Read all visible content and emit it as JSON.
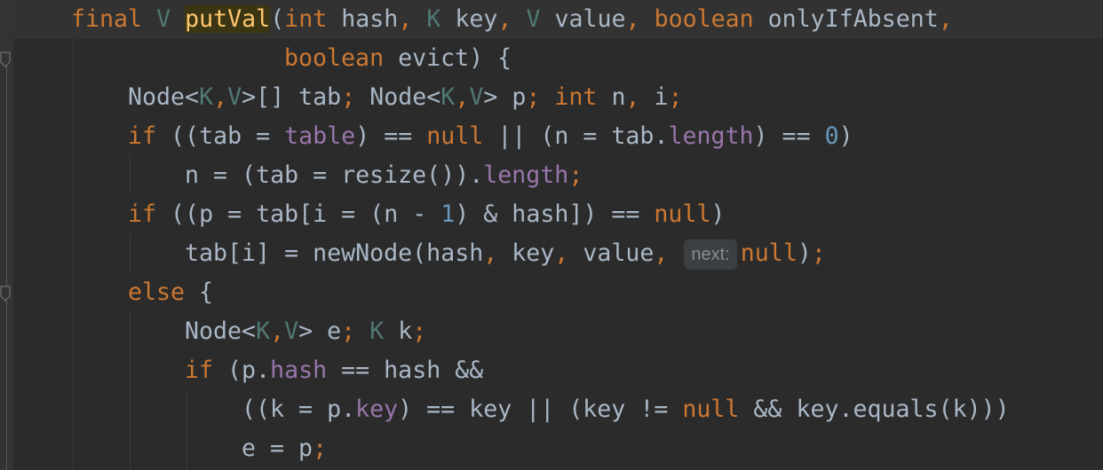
{
  "editor": {
    "lines": [
      [
        {
          "t": "final",
          "c": "kw"
        },
        {
          "t": " "
        },
        {
          "t": "V",
          "c": "typ"
        },
        {
          "t": " "
        },
        {
          "t": "putVal",
          "c": "fn-decl"
        },
        {
          "t": "("
        },
        {
          "t": "int",
          "c": "kw"
        },
        {
          "t": " hash"
        },
        {
          "t": ",",
          "c": "kw"
        },
        {
          "t": " "
        },
        {
          "t": "K",
          "c": "typ"
        },
        {
          "t": " key"
        },
        {
          "t": ",",
          "c": "kw"
        },
        {
          "t": " "
        },
        {
          "t": "V",
          "c": "typ"
        },
        {
          "t": " value"
        },
        {
          "t": ",",
          "c": "kw"
        },
        {
          "t": " "
        },
        {
          "t": "boolean",
          "c": "kw"
        },
        {
          "t": " onlyIfAbsent"
        },
        {
          "t": ",",
          "c": "kw"
        }
      ],
      [
        {
          "t": "boolean",
          "c": "kw"
        },
        {
          "t": " evict) {"
        }
      ],
      [
        {
          "t": "Node<"
        },
        {
          "t": "K",
          "c": "typ"
        },
        {
          "t": ",",
          "c": "kw"
        },
        {
          "t": "V",
          "c": "typ"
        },
        {
          "t": ">[] tab"
        },
        {
          "t": ";",
          "c": "kw"
        },
        {
          "t": " Node<"
        },
        {
          "t": "K",
          "c": "typ"
        },
        {
          "t": ",",
          "c": "kw"
        },
        {
          "t": "V",
          "c": "typ"
        },
        {
          "t": "> p"
        },
        {
          "t": ";",
          "c": "kw"
        },
        {
          "t": " "
        },
        {
          "t": "int",
          "c": "kw"
        },
        {
          "t": " n"
        },
        {
          "t": ",",
          "c": "kw"
        },
        {
          "t": " i"
        },
        {
          "t": ";",
          "c": "kw"
        }
      ],
      [
        {
          "t": "if",
          "c": "kw"
        },
        {
          "t": " ((tab = "
        },
        {
          "t": "table",
          "c": "fld"
        },
        {
          "t": ") == "
        },
        {
          "t": "null",
          "c": "kw"
        },
        {
          "t": " || (n = tab."
        },
        {
          "t": "length",
          "c": "fld"
        },
        {
          "t": ") == "
        },
        {
          "t": "0",
          "c": "num"
        },
        {
          "t": ")"
        }
      ],
      [
        {
          "t": "n = (tab = resize())."
        },
        {
          "t": "length",
          "c": "fld"
        },
        {
          "t": ";",
          "c": "kw"
        }
      ],
      [
        {
          "t": "if",
          "c": "kw"
        },
        {
          "t": " ((p = tab[i = (n - "
        },
        {
          "t": "1",
          "c": "num"
        },
        {
          "t": ") & hash]) == "
        },
        {
          "t": "null",
          "c": "kw"
        },
        {
          "t": ")"
        }
      ],
      [
        {
          "t": "tab[i] = newNode(hash"
        },
        {
          "t": ",",
          "c": "kw"
        },
        {
          "t": " key"
        },
        {
          "t": ",",
          "c": "kw"
        },
        {
          "t": " value"
        },
        {
          "t": ",",
          "c": "kw"
        },
        {
          "t": " "
        },
        {
          "t": "next:",
          "c": "hint"
        },
        {
          "t": "null",
          "c": "kw"
        },
        {
          "t": ")"
        },
        {
          "t": ";",
          "c": "kw"
        }
      ],
      [
        {
          "t": "else",
          "c": "kw"
        },
        {
          "t": " {"
        }
      ],
      [
        {
          "t": "Node<"
        },
        {
          "t": "K",
          "c": "typ"
        },
        {
          "t": ",",
          "c": "kw"
        },
        {
          "t": "V",
          "c": "typ"
        },
        {
          "t": "> e"
        },
        {
          "t": ";",
          "c": "kw"
        },
        {
          "t": " "
        },
        {
          "t": "K",
          "c": "typ"
        },
        {
          "t": " k"
        },
        {
          "t": ";",
          "c": "kw"
        }
      ],
      [
        {
          "t": "if",
          "c": "kw"
        },
        {
          "t": " (p."
        },
        {
          "t": "hash",
          "c": "fld"
        },
        {
          "t": " == hash &&"
        }
      ],
      [
        {
          "t": "((k = p."
        },
        {
          "t": "key",
          "c": "fld"
        },
        {
          "t": ") == key || (key != "
        },
        {
          "t": "null",
          "c": "kw"
        },
        {
          "t": " && key.equals(k)))"
        }
      ],
      [
        {
          "t": "e = p"
        },
        {
          "t": ";",
          "c": "kw"
        }
      ]
    ]
  }
}
